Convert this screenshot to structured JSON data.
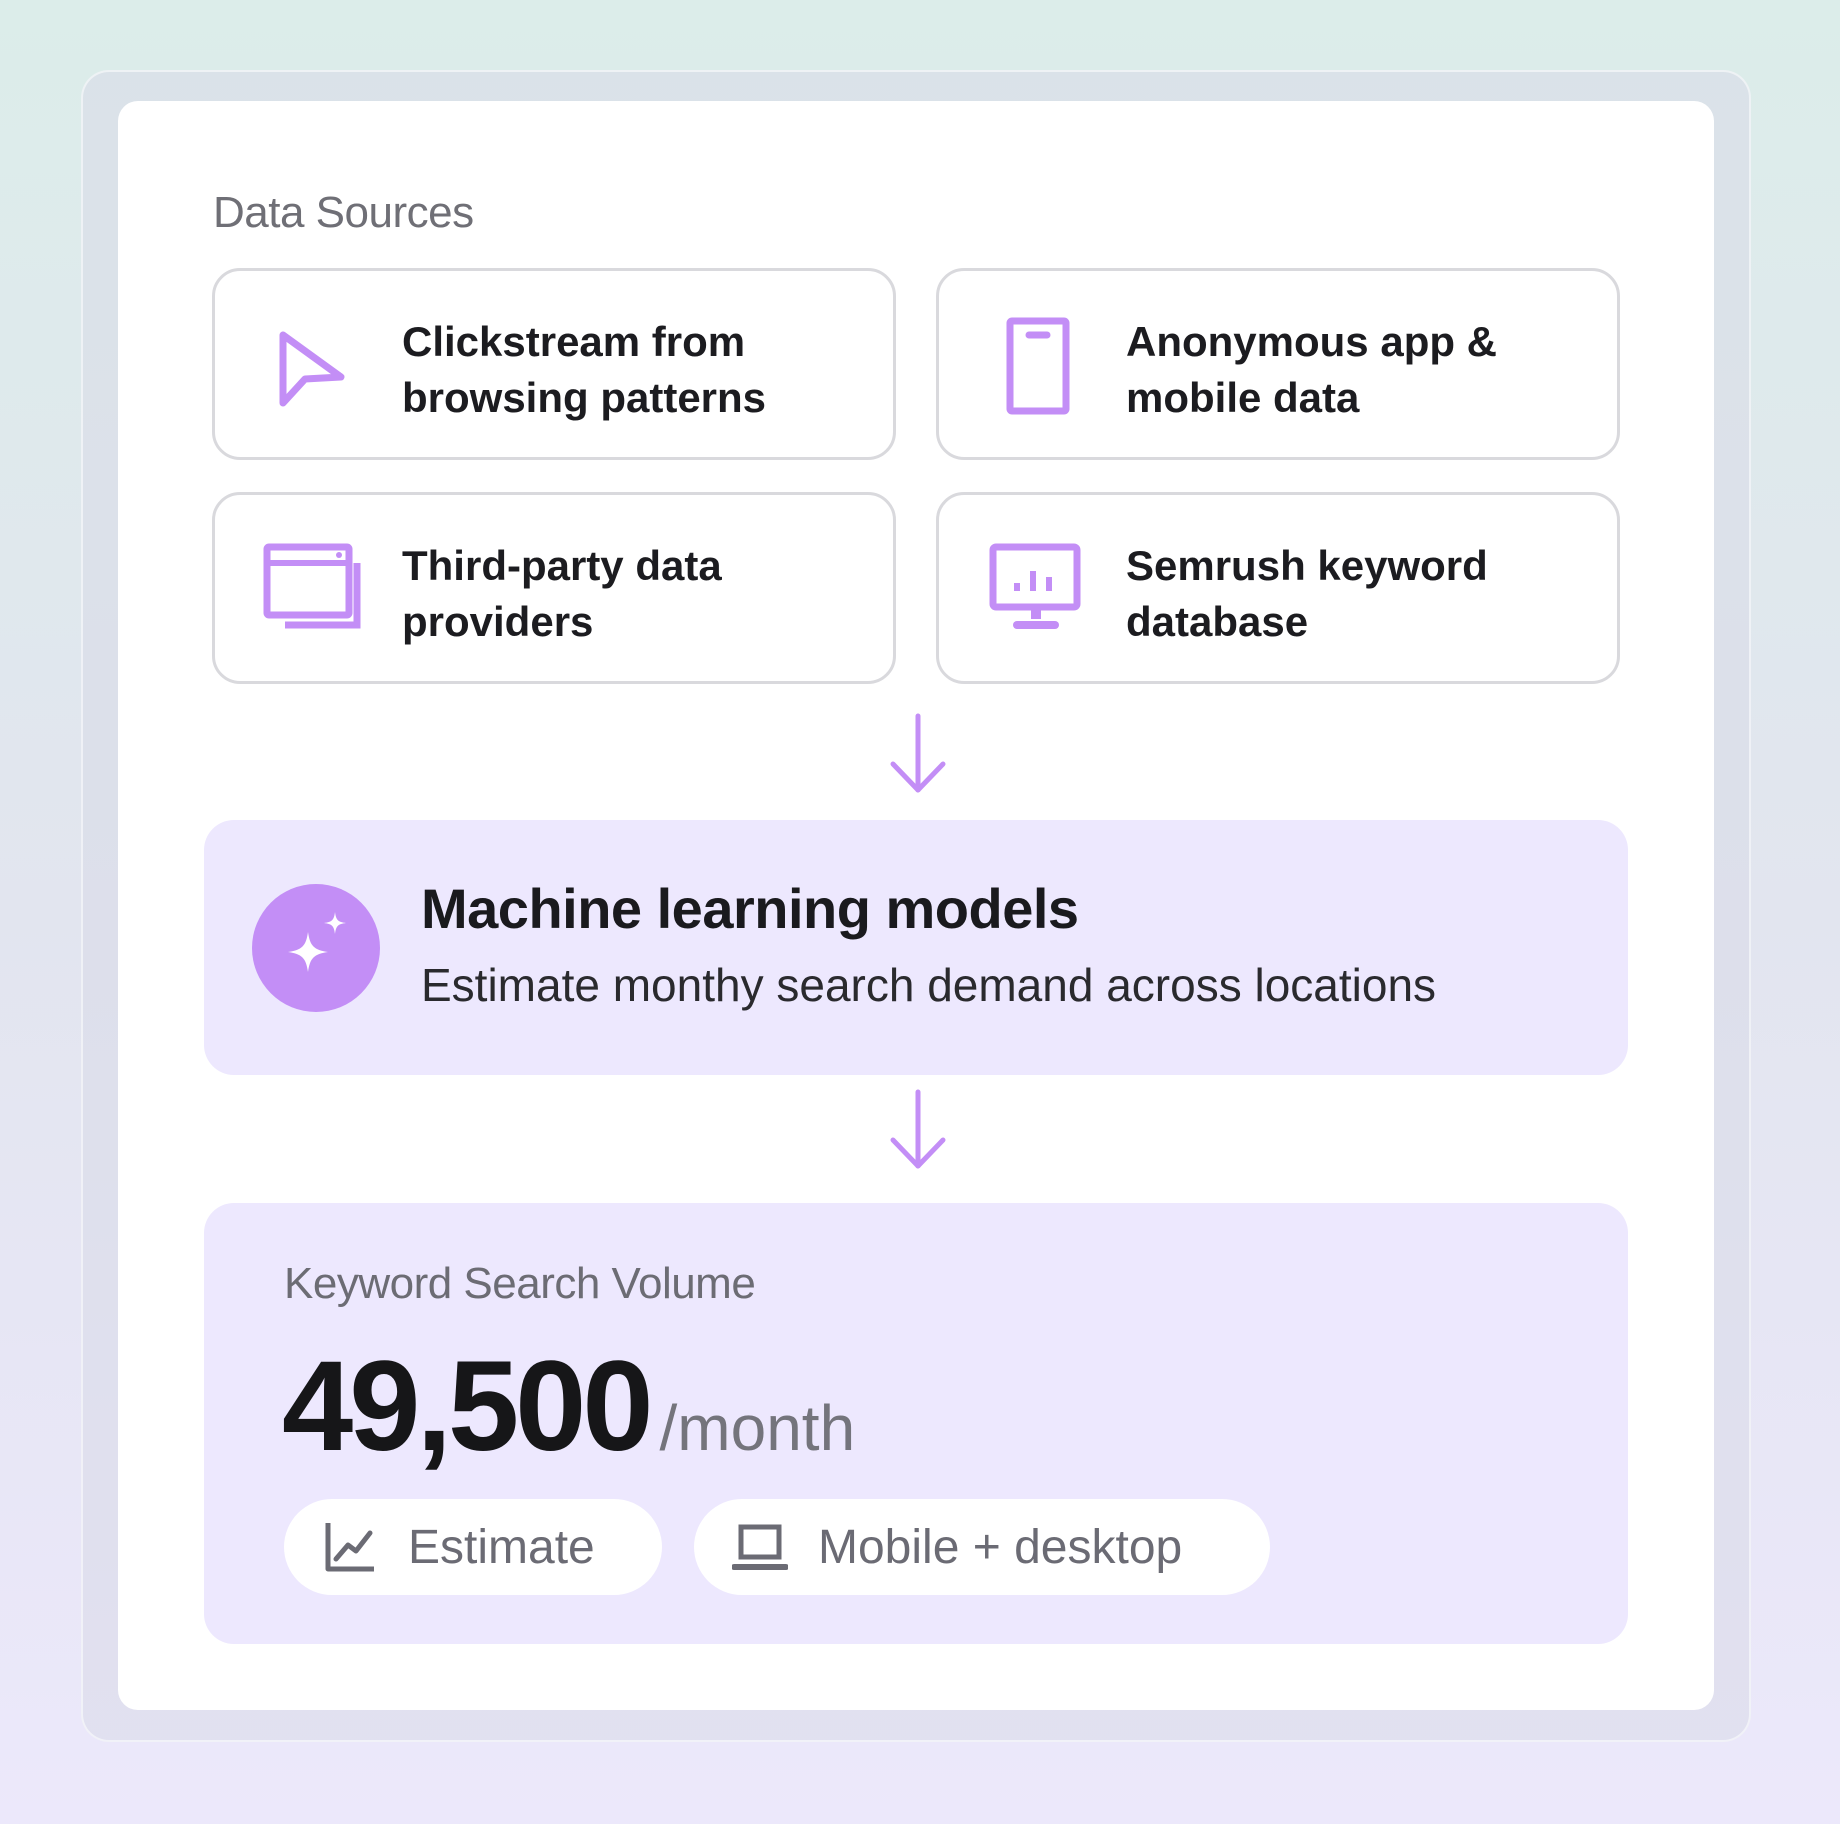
{
  "colors": {
    "accent": "#c38ef6",
    "panel": "#ede8fe",
    "border": "#d9d9dd"
  },
  "data_sources": {
    "title": "Data Sources",
    "items": [
      {
        "icon": "cursor-icon",
        "label": "Clickstream from browsing patterns"
      },
      {
        "icon": "mobile-phone-icon",
        "label": "Anonymous app & mobile data"
      },
      {
        "icon": "browser-windows-icon",
        "label": "Third-party data providers"
      },
      {
        "icon": "monitor-chart-icon",
        "label": "Semrush keyword database"
      }
    ]
  },
  "ml": {
    "icon": "sparkles-icon",
    "title": "Machine learning models",
    "subtitle": "Estimate monthy search demand across locations"
  },
  "volume": {
    "label": "Keyword Search Volume",
    "value": "49,500",
    "unit": "/month",
    "tags": [
      {
        "icon": "line-chart-icon",
        "label": "Estimate"
      },
      {
        "icon": "laptop-icon",
        "label": "Mobile + desktop"
      }
    ]
  }
}
